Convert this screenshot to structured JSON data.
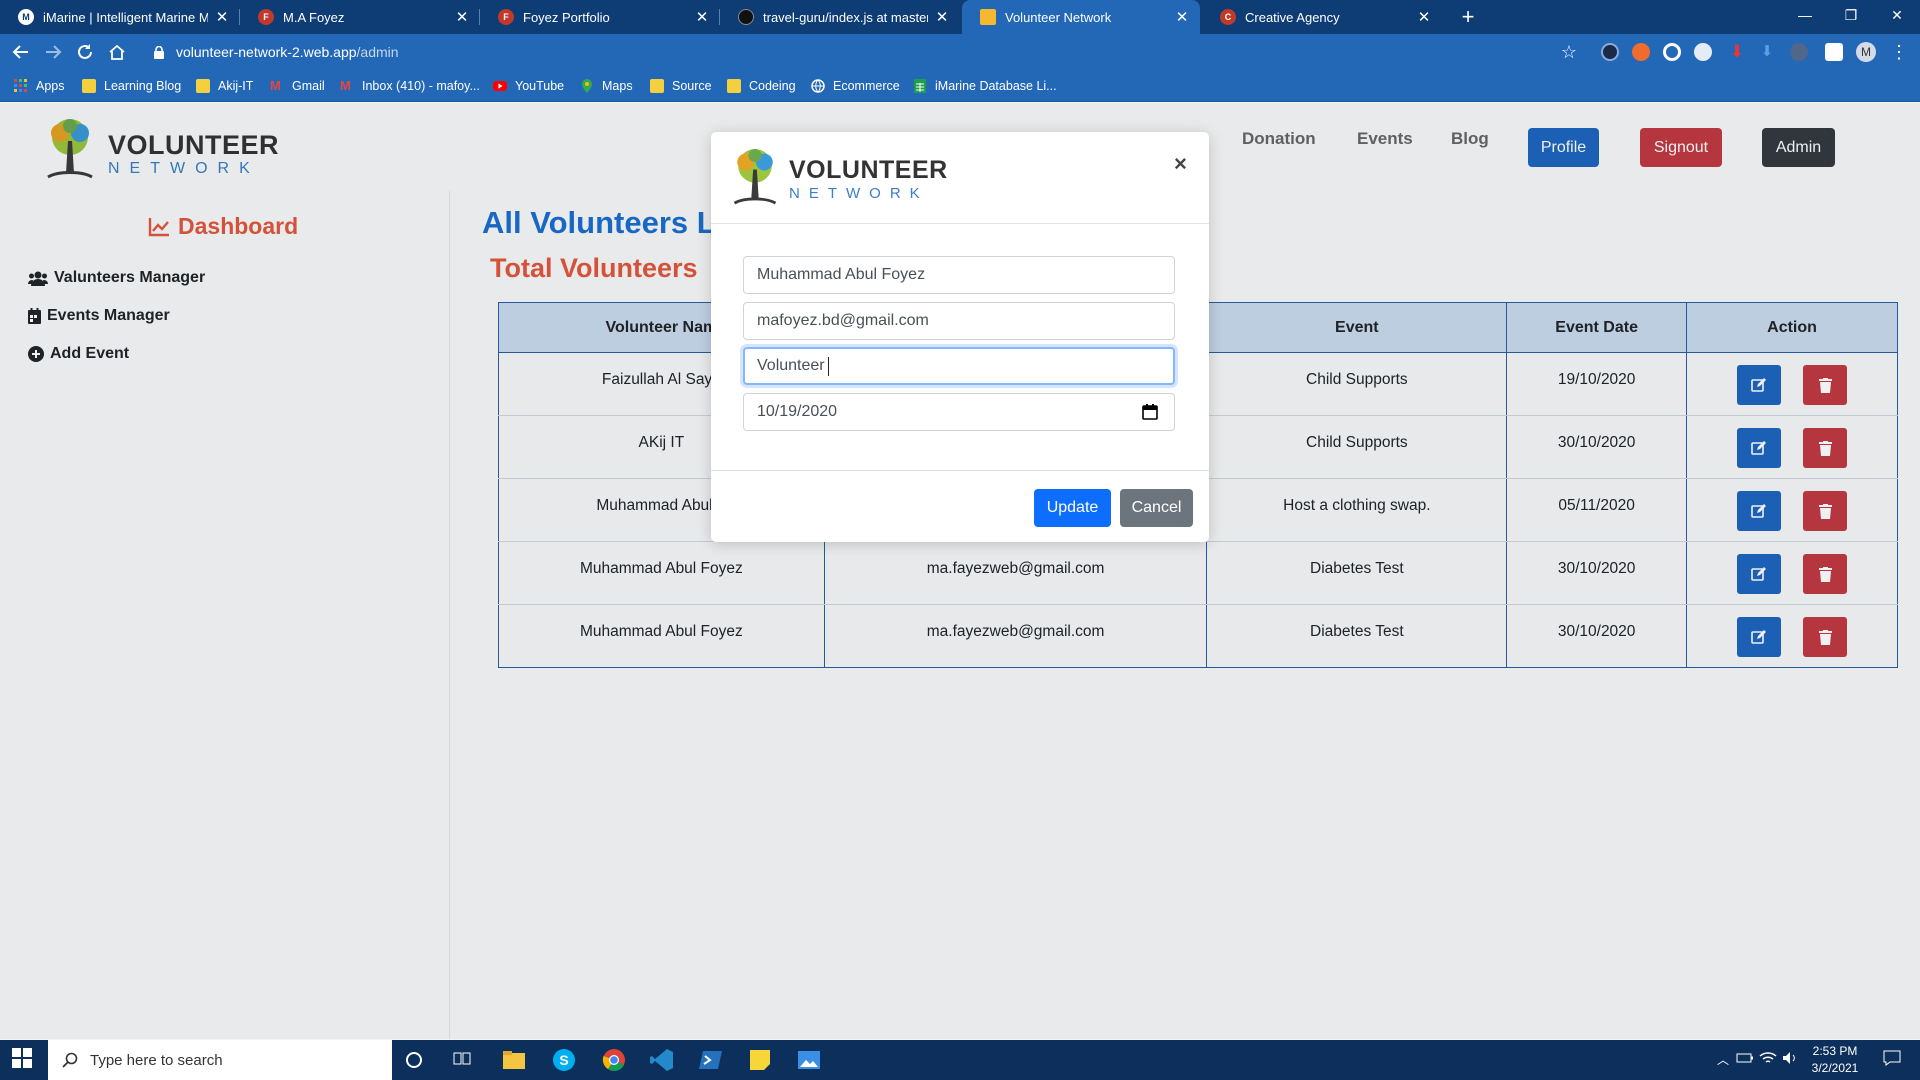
{
  "browser": {
    "tabs": [
      {
        "title": "iMarine | Intelligent Marine Mana",
        "favicon": "imarine-icon",
        "active": false
      },
      {
        "title": "M.A Foyez",
        "favicon": "portfolio-icon",
        "active": false
      },
      {
        "title": "Foyez Portfolio",
        "favicon": "portfolio-icon",
        "active": false
      },
      {
        "title": "travel-guru/index.js at master · m",
        "favicon": "github-icon",
        "active": false
      },
      {
        "title": "Volunteer Network",
        "favicon": "volunteer-icon",
        "active": true
      },
      {
        "title": "Creative Agency",
        "favicon": "agency-icon",
        "active": false
      }
    ],
    "url_host": "volunteer-network-2.web.app",
    "url_path": "/admin",
    "profile_initial": "M",
    "bookmarks": [
      {
        "label": "Apps",
        "icon": "apps-grid-icon"
      },
      {
        "label": "Learning Blog",
        "icon": "folder-icon"
      },
      {
        "label": "Akij-IT",
        "icon": "folder-icon"
      },
      {
        "label": "Gmail",
        "icon": "gmail-icon"
      },
      {
        "label": "Inbox (410) - mafoy...",
        "icon": "gmail-icon"
      },
      {
        "label": "YouTube",
        "icon": "youtube-icon"
      },
      {
        "label": "Maps",
        "icon": "maps-icon"
      },
      {
        "label": "Source",
        "icon": "folder-icon"
      },
      {
        "label": "Codeing",
        "icon": "folder-icon"
      },
      {
        "label": "Ecommerce",
        "icon": "globe-icon"
      },
      {
        "label": "iMarine Database Li...",
        "icon": "sheets-icon"
      }
    ]
  },
  "site": {
    "logo_line1": "VOLUNTEER",
    "logo_line2": "NETWORK",
    "nav": [
      "Donation",
      "Events",
      "Blog"
    ],
    "buttons": {
      "profile": "Profile",
      "signout": "Signout",
      "admin": "Admin"
    }
  },
  "sidebar": {
    "title": "Dashboard",
    "items": [
      {
        "label": "Valunteers Manager",
        "icon": "users-icon"
      },
      {
        "label": "Events Manager",
        "icon": "calendar-icon"
      },
      {
        "label": "Add Event",
        "icon": "plus-circle-icon"
      }
    ]
  },
  "main": {
    "heading": "All Volunteers L",
    "subheading": "Total Volunteers",
    "table": {
      "columns": [
        "Volunteer Nam",
        "",
        "Event",
        "Event Date",
        "Action"
      ],
      "rows": [
        {
          "name": "Faizullah Al Saye",
          "email": "",
          "event": "Child Supports",
          "date": "19/10/2020"
        },
        {
          "name": "AKij IT",
          "email": "",
          "event": "Child Supports",
          "date": "30/10/2020"
        },
        {
          "name": "Muhammad Abul F",
          "email": "",
          "event": "Host a clothing swap.",
          "date": "05/11/2020"
        },
        {
          "name": "Muhammad Abul Foyez",
          "email": "ma.fayezweb@gmail.com",
          "event": "Diabetes Test",
          "date": "30/10/2020"
        },
        {
          "name": "Muhammad Abul Foyez",
          "email": "ma.fayezweb@gmail.com",
          "event": "Diabetes Test",
          "date": "30/10/2020"
        }
      ]
    }
  },
  "modal": {
    "logo_line1": "VOLUNTEER",
    "logo_line2": "NETWORK",
    "close_glyph": "×",
    "fields": {
      "name": "Muhammad Abul Foyez",
      "email": "mafoyez.bd@gmail.com",
      "role": "Volunteer",
      "date": "10/19/2020"
    },
    "update_label": "Update",
    "cancel_label": "Cancel"
  },
  "taskbar": {
    "search_placeholder": "Type here to search",
    "time": "2:53 PM",
    "date": "3/2/2021"
  },
  "colors": {
    "tabbar": "#0e3c74",
    "toolbar": "#2367b7",
    "primary": "#1e66c2",
    "danger": "#c23a45",
    "accent_orange": "#e2583e",
    "heading_blue": "#1a6fd0"
  }
}
